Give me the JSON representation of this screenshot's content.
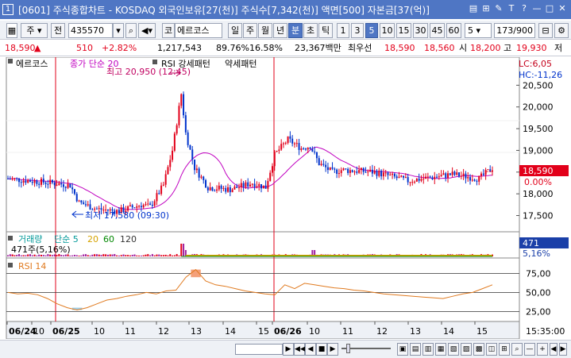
{
  "window": {
    "number": "1",
    "title": "[0601] 주식종합차트 - KOSDAQ 외국인보유[27(천)] 주식수[7,342(천)] 액면[500] 자본금[37(억)]",
    "controls": [
      "▤",
      "⊞",
      "✎",
      "T",
      "?",
      "—",
      "□",
      "✕"
    ]
  },
  "toolbar": {
    "market_select": "주",
    "market_toggle": "전",
    "code_value": "435570",
    "stock_prefix": "코",
    "stock_name": "에르코스",
    "periods": [
      "일",
      "주",
      "월",
      "년",
      "분",
      "초",
      "틱"
    ],
    "active_period": "분",
    "intervals": [
      "1",
      "3",
      "5",
      "10",
      "15",
      "30",
      "45",
      "60"
    ],
    "active_interval": "5",
    "count_value": "5",
    "range_value": "173/900"
  },
  "quote": {
    "price": "18,590",
    "change": "510",
    "change_pct": "+2.82%",
    "volume": "1,217,543",
    "vol_ratio": "89.76%",
    "turnover": "16.58%",
    "amount": "23,367백만",
    "best_label": "최우선",
    "best_price": "18,590",
    "ask_price": "18,560",
    "open_label": "시",
    "open_price": "18,200",
    "high_label": "고",
    "high_price": "19,930",
    "low_label": "저"
  },
  "price_pane": {
    "tag_stock": "에르코스",
    "tag_ma": "종가 단순 20",
    "tag_rsi_strength": "RSI 강세패턴",
    "tag_rsi_weak": "약세패턴",
    "lc": "LC:6,05",
    "hc": "HC:-11,26",
    "high_marker": "최고 20,950 (12:45)",
    "low_marker": "최저 17,580 (09:30)",
    "current_price": "18,590",
    "current_pct": "0.00%",
    "y_ticks": [
      "20,500",
      "20,000",
      "19,500",
      "19,000",
      "18,500",
      "18,000",
      "17,500"
    ]
  },
  "volume_pane": {
    "tag_volume": "거래량",
    "tag_ma": "단순 5",
    "ma_periods": [
      "20",
      "60",
      "120"
    ],
    "value_label": "471주(5,16%)",
    "badge_value": "471",
    "badge_pct": "5,16%"
  },
  "rsi_pane": {
    "tag": "RSI 14",
    "y_ticks": [
      "75,00",
      "50,00",
      "25,00"
    ]
  },
  "x_axis": {
    "labels": [
      "06/24",
      "10",
      "06/25",
      "10",
      "11",
      "12",
      "13",
      "14",
      "15",
      "06/26",
      "10",
      "11",
      "12",
      "13",
      "14",
      "15"
    ],
    "time": "15:35:00"
  },
  "colors": {
    "up": "#e2001a",
    "down": "#0033cc",
    "ma": "#c000c0",
    "rsi": "#e07a1f",
    "rsi_fill_up": "#f4a07a",
    "rsi_fill_down": "#9ecfea",
    "titlebar": "#4f76c4"
  },
  "chart_data": {
    "type": "candlestick",
    "series": [
      {
        "name": "RSI 14",
        "values": [
          50,
          48,
          49,
          47,
          42,
          35,
          30,
          27,
          30,
          35,
          40,
          42,
          45,
          47,
          50,
          48,
          52,
          53,
          70,
          80,
          65,
          60,
          58,
          55,
          52,
          50,
          48,
          47,
          60,
          55,
          62,
          60,
          58,
          56,
          55,
          53,
          52,
          50,
          48,
          47,
          46,
          45,
          44,
          43,
          42,
          45,
          48,
          50,
          55,
          60
        ]
      }
    ],
    "y_range": [
      17400,
      21000
    ],
    "rsi_range": [
      15,
      90
    ]
  }
}
